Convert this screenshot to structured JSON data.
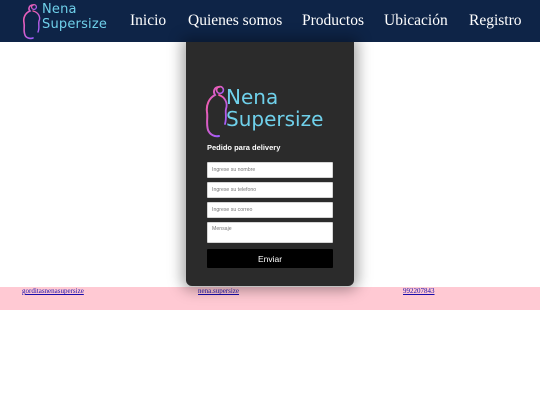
{
  "brand": {
    "name_line1": "Nena",
    "name_line2": "Supersize",
    "color": "#6fd0ea"
  },
  "nav": {
    "items": [
      {
        "label": "Inicio"
      },
      {
        "label": "Quienes somos"
      },
      {
        "label": "Productos"
      },
      {
        "label": "Ubicación"
      },
      {
        "label": "Registro"
      }
    ],
    "background": "#0e2447"
  },
  "form": {
    "title": "Pedido para delivery",
    "name_placeholder": "Ingrese su nombre",
    "phone_placeholder": "Ingrese su telefono",
    "email_placeholder": "Ingrese su correo",
    "message_placeholder": "Mensaje",
    "submit_label": "Enviar"
  },
  "footer": {
    "links": [
      {
        "label": "gorditasnenasupersize"
      },
      {
        "label": "nena.supersize"
      },
      {
        "label": "992207843"
      }
    ],
    "background": "#ffc9d3"
  }
}
